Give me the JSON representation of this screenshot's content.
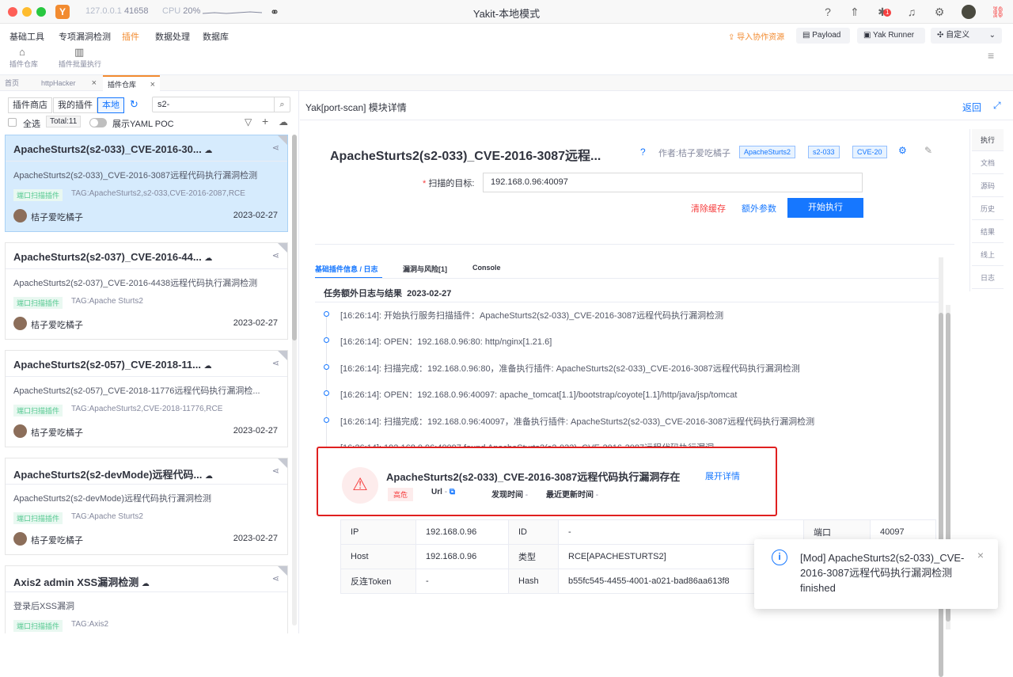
{
  "titlebar": {
    "address": "127.0.0.1",
    "port": "41658",
    "cpu_label": "CPU",
    "cpu_value": "20%",
    "title": "Yakit-本地模式",
    "bug_count": "1"
  },
  "menu": {
    "items": [
      "基础工具",
      "专项漏洞检测",
      "插件",
      "数据处理",
      "数据库"
    ],
    "sub_items": [
      "插件仓库",
      "插件批量执行"
    ],
    "import_label": "导入协作资源",
    "payload_label": "Payload",
    "yakrunner_label": "Yak Runner",
    "custom_label": "自定义"
  },
  "tabs": {
    "home": "首页",
    "http": "httpHacker",
    "store": "插件仓库"
  },
  "left": {
    "seg": [
      "插件商店",
      "我的插件",
      "本地"
    ],
    "search_value": "s2-",
    "select_all": "全选",
    "total": "Total:11",
    "yaml_label": "展示YAML POC"
  },
  "cards": [
    {
      "title": "ApacheSturts2(s2-033)_CVE-2016-30...",
      "desc": "ApacheSturts2(s2-033)_CVE-2016-3087远程代码执行漏洞检测",
      "tag": "端口扫描插件",
      "tagtext": "TAG:ApacheSturts2,s2-033,CVE-2016-2087,RCE",
      "author": "桔子爱吃橘子",
      "date": "2023-02-27"
    },
    {
      "title": "ApacheSturts2(s2-037)_CVE-2016-44...",
      "desc": "ApacheSturts2(s2-037)_CVE-2016-4438远程代码执行漏洞检测",
      "tag": "端口扫描插件",
      "tagtext": "TAG:Apache Sturts2",
      "author": "桔子爱吃橘子",
      "date": "2023-02-27"
    },
    {
      "title": "ApacheSturts2(s2-057)_CVE-2018-11...",
      "desc": "ApacheSturts2(s2-057)_CVE-2018-11776远程代码执行漏洞检...",
      "tag": "端口扫描插件",
      "tagtext": "TAG:ApacheSturts2,CVE-2018-11776,RCE",
      "author": "桔子爱吃橘子",
      "date": "2023-02-27"
    },
    {
      "title": "ApacheSturts2(s2-devMode)远程代码...",
      "desc": "ApacheSturts2(s2-devMode)远程代码执行漏洞检测",
      "tag": "端口扫描插件",
      "tagtext": "TAG:Apache Sturts2",
      "author": "桔子爱吃橘子",
      "date": "2023-02-27"
    },
    {
      "title": "Axis2 admin XSS漏洞检测",
      "desc": "登录后XSS漏洞",
      "tag": "端口扫描插件",
      "tagtext": "TAG:Axis2",
      "author": "",
      "date": ""
    }
  ],
  "detail": {
    "header": "Yak[port-scan] 模块详情",
    "back": "返回",
    "plugin_name": "ApacheSturts2(s2-033)_CVE-2016-3087远程...",
    "author": "作者:桔子爱吃橘子",
    "tags": [
      "ApacheSturts2",
      "s2-033",
      "CVE-20"
    ],
    "target_label": "扫描的目标:",
    "target_value": "192.168.0.96:40097",
    "clear_cache": "清除缓存",
    "extra_params": "额外参数",
    "start": "开始执行",
    "side_tabs": [
      "执行",
      "文档",
      "源码",
      "历史",
      "结果",
      "线上",
      "日志"
    ]
  },
  "result": {
    "tabs": [
      "基础插件信息 / 日志",
      "漏洞与风险[1]",
      "Console"
    ],
    "section_title": "任务额外日志与结果",
    "section_date": "2023-02-27",
    "logs": [
      "[16:26:14]: 开始执行服务扫描插件：ApacheSturts2(s2-033)_CVE-2016-3087远程代码执行漏洞检测",
      "[16:26:14]: OPEN：192.168.0.96:80: http/nginx[1.21.6]",
      "[16:26:14]: 扫描完成：192.168.0.96:80，准备执行插件: ApacheSturts2(s2-033)_CVE-2016-3087远程代码执行漏洞检测",
      "[16:26:14]: OPEN：192.168.0.96:40097: apache_tomcat[1.1]/bootstrap/coyote[1.1]/http/java/jsp/tomcat",
      "[16:26:14]: 扫描完成：192.168.0.96:40097，准备执行插件: ApacheSturts2(s2-033)_CVE-2016-3087远程代码执行漏洞检测",
      "[16:26:14]: 192.168.0.96:40097 found ApacheSturts2(s2-033)_CVE-2016-3087远程代码执行漏洞"
    ],
    "vuln_title": "ApacheSturts2(s2-033)_CVE-2016-3087远程代码执行漏洞存在",
    "expand": "展开详情",
    "severity": "高危",
    "url_label": "Url",
    "dash": "-",
    "found_time_label": "发现时间",
    "updated_label": "最近更新时间",
    "table": {
      "ip_k": "IP",
      "ip_v": "192.168.0.96",
      "id_k": "ID",
      "id_v": "-",
      "port_k": "端口",
      "port_v": "40097",
      "host_k": "Host",
      "host_v": "192.168.0.96",
      "type_k": "类型",
      "type_v": "RCE[APACHESTURTS2]",
      "token_k": "反连Token",
      "token_v": "-",
      "hash_k": "Hash",
      "hash_v": "b55fc545-4455-4001-a021-bad86aa613f8"
    }
  },
  "toast": {
    "message": "[Mod] ApacheSturts2(s2-033)_CVE-2016-3087远程代码执行漏洞检测 finished"
  }
}
